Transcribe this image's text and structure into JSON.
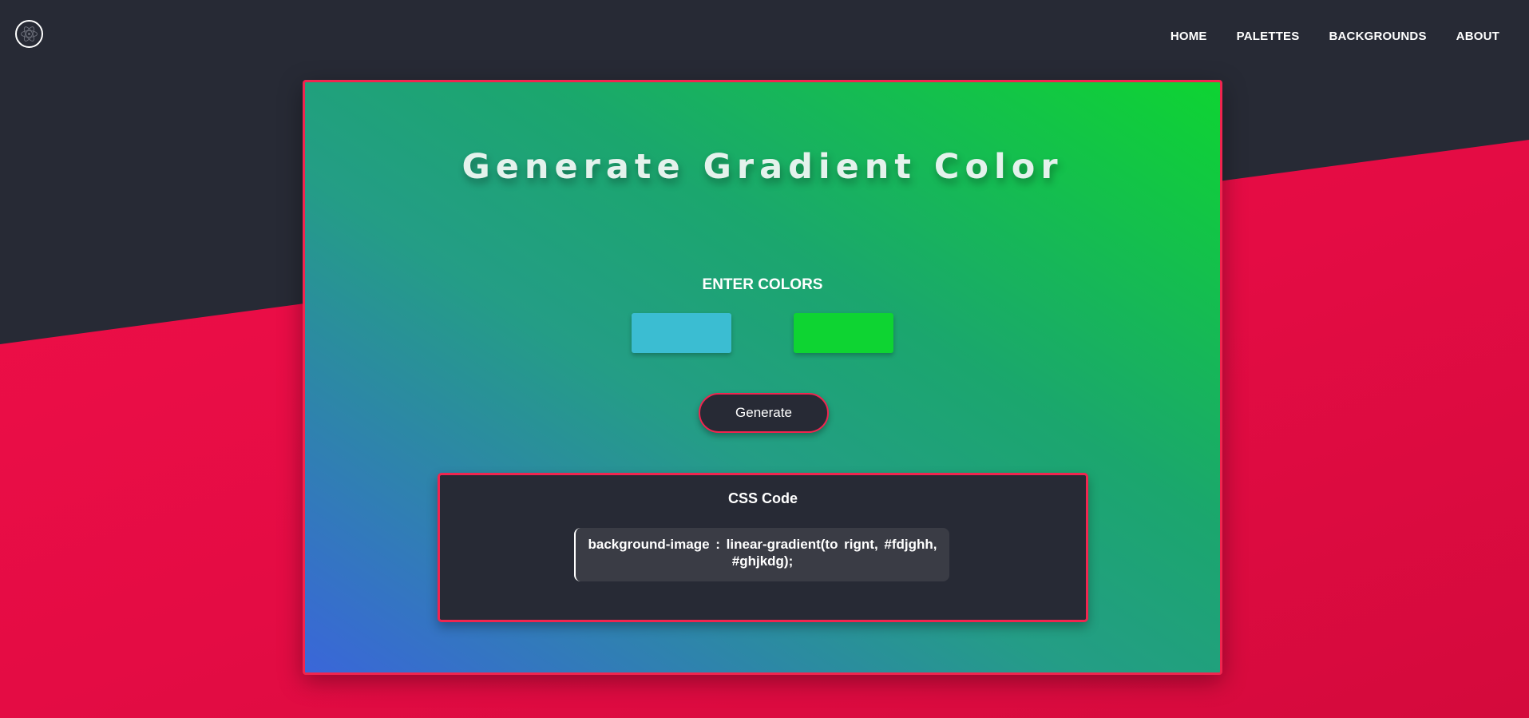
{
  "navbar": {
    "logo_icon": "atom-logo-icon",
    "links": [
      {
        "label": "HOME"
      },
      {
        "label": "PALETTES"
      },
      {
        "label": "BACKGROUNDS"
      },
      {
        "label": "ABOUT"
      }
    ]
  },
  "main": {
    "title": "Generate Gradient Color",
    "enter_label": "ENTER COLORS",
    "color_inputs": [
      {
        "value": "#3bbdd2"
      },
      {
        "value": "#0ed432"
      }
    ],
    "generate_label": "Generate",
    "code_panel": {
      "title": "CSS Code",
      "code": "background-image : linear-gradient(to rignt, #fdjghh, #ghjkdg);"
    }
  },
  "colors": {
    "page_background": "#272a35",
    "accent_red": "#f20f49",
    "card_border": "#f0254f",
    "gradient_start": "#3a66d9",
    "gradient_end": "#0ed432"
  }
}
